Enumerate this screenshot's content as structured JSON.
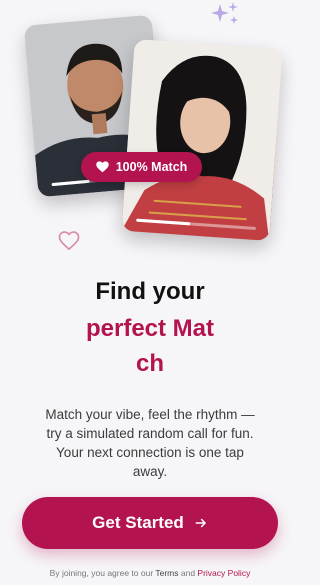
{
  "colors": {
    "accent": "#b3134f",
    "background": "#f6f5f8",
    "sparkle": "#b8a8e6"
  },
  "cards": {
    "left": {
      "progress": 0.38
    },
    "right": {
      "progress": 0.45
    }
  },
  "match_badge": {
    "label": "100% Match",
    "icon": "heart-icon"
  },
  "headline": {
    "line1": "Find your",
    "line2": "perfect Mat",
    "line3": "ch"
  },
  "subtitle": "Match your vibe, feel the rhythm — try a simulated random call for fun. Your next connection is one tap away.",
  "cta": {
    "label": "Get Started",
    "icon": "arrow-right-icon"
  },
  "legal": {
    "prefix": "By joining, you agree to our ",
    "terms": "Terms",
    "and": " and ",
    "privacy": "Privacy Policy"
  }
}
